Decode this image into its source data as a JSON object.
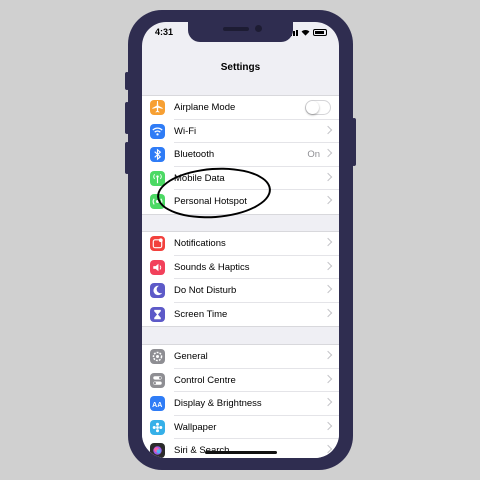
{
  "status_bar": {
    "time": "4:31"
  },
  "nav": {
    "title": "Settings"
  },
  "groups": [
    [
      {
        "label": "Airplane Mode",
        "icon": "airplane-icon",
        "color": "#f7a033",
        "accessory": "toggle"
      },
      {
        "label": "Wi-Fi",
        "icon": "wifi-icon",
        "color": "#2f7cf6",
        "accessory": "chevron"
      },
      {
        "label": "Bluetooth",
        "icon": "bluetooth-icon",
        "color": "#2f7cf6",
        "value": "On",
        "accessory": "chevron"
      },
      {
        "label": "Mobile Data",
        "icon": "antenna-icon",
        "color": "#4cd964",
        "accessory": "chevron"
      },
      {
        "label": "Personal Hotspot",
        "icon": "hotspot-icon",
        "color": "#4cd964",
        "accessory": "chevron"
      }
    ],
    [
      {
        "label": "Notifications",
        "icon": "notification-icon",
        "color": "#f2413d",
        "accessory": "chevron"
      },
      {
        "label": "Sounds & Haptics",
        "icon": "speaker-icon",
        "color": "#f2415b",
        "accessory": "chevron"
      },
      {
        "label": "Do Not Disturb",
        "icon": "moon-icon",
        "color": "#5d5ac8",
        "accessory": "chevron"
      },
      {
        "label": "Screen Time",
        "icon": "hourglass-icon",
        "color": "#5d5ac8",
        "accessory": "chevron"
      }
    ],
    [
      {
        "label": "General",
        "icon": "gear-icon",
        "color": "#8e8e93",
        "accessory": "chevron"
      },
      {
        "label": "Control Centre",
        "icon": "switches-icon",
        "color": "#8e8e93",
        "accessory": "chevron"
      },
      {
        "label": "Display & Brightness",
        "icon": "text-size-icon",
        "color": "#2f7cf6",
        "accessory": "chevron"
      },
      {
        "label": "Wallpaper",
        "icon": "flower-icon",
        "color": "#36b0e8",
        "accessory": "chevron"
      },
      {
        "label": "Siri & Search",
        "icon": "siri-icon",
        "color": "#2b2b2b",
        "accessory": "chevron"
      }
    ]
  ]
}
